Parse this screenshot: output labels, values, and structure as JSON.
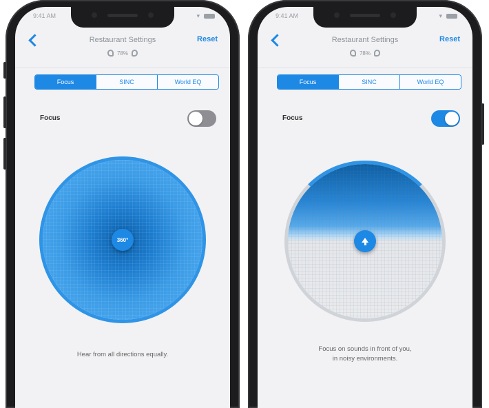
{
  "screens": [
    {
      "status_time": "9:41 AM",
      "title": "Restaurant Settings",
      "reset_label": "Reset",
      "battery_percent": "78%",
      "tabs": [
        "Focus",
        "SINC",
        "World EQ"
      ],
      "active_tab": 0,
      "focus_label": "Focus",
      "focus_on": false,
      "center_label": "360°",
      "description_line1": "Hear from all directions equally.",
      "description_line2": ""
    },
    {
      "status_time": "9:41 AM",
      "title": "Restaurant Settings",
      "reset_label": "Reset",
      "battery_percent": "78%",
      "tabs": [
        "Focus",
        "SINC",
        "World EQ"
      ],
      "active_tab": 0,
      "focus_label": "Focus",
      "focus_on": true,
      "center_icon": "arrow-up-icon",
      "description_line1": "Focus on sounds in front of you,",
      "description_line2": "in noisy environments."
    }
  ],
  "colors": {
    "accent": "#1e88e5",
    "toggle_off": "#8e8e93",
    "background": "#f2f2f4"
  }
}
